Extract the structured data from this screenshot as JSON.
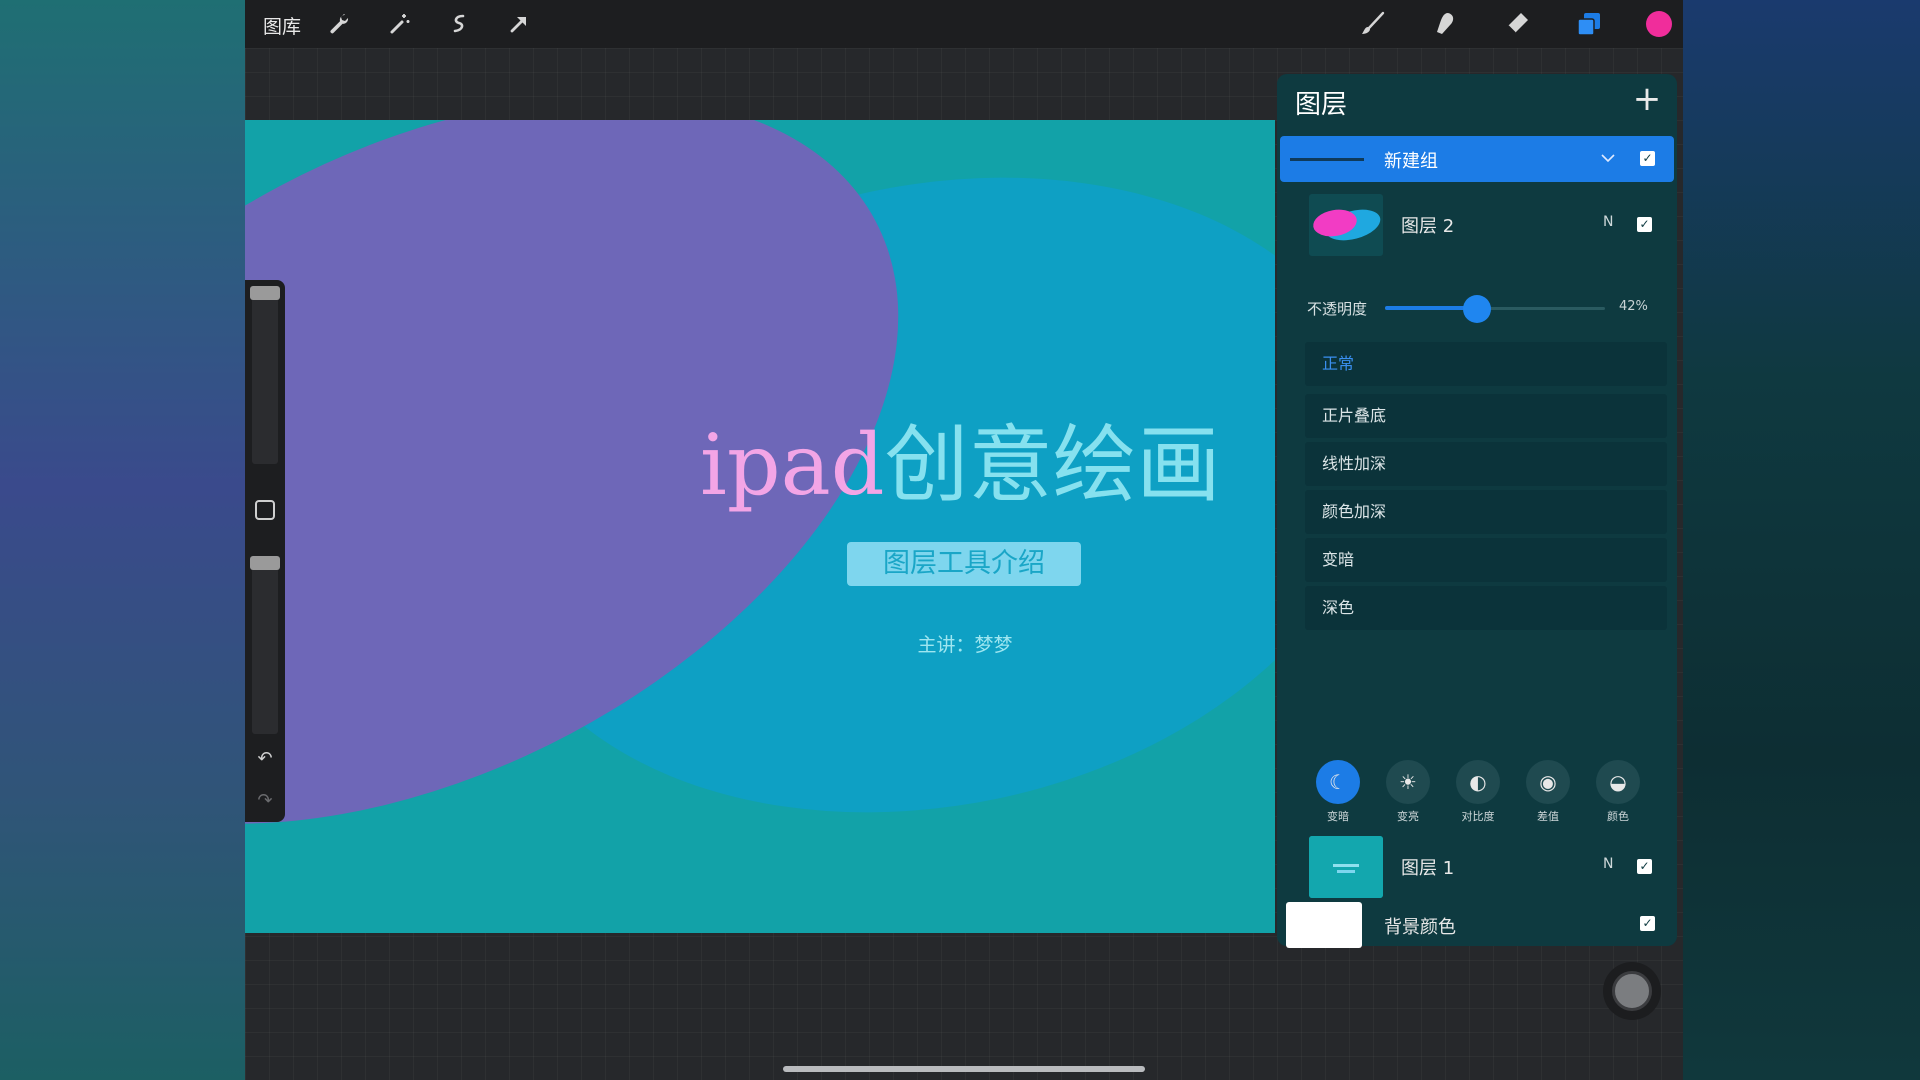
{
  "toolbar": {
    "gallery_label": "图库",
    "icons": [
      "wrench-icon",
      "magic-wand-icon",
      "selection-icon",
      "transform-arrow-icon",
      "brush-icon",
      "smudge-icon",
      "eraser-icon",
      "layers-icon",
      "color-swatch-icon"
    ],
    "color": "#f02d9b"
  },
  "canvas": {
    "title_latin": "ipad",
    "title_cjk": "创意绘画",
    "subtitle": "图层工具介绍",
    "speaker": "主讲：梦梦"
  },
  "layers_panel": {
    "title": "图层",
    "add_symbol": "+",
    "group": {
      "name": "新建组",
      "checked": true
    },
    "layer2": {
      "name": "图层 2",
      "blend": "N",
      "checked": true
    },
    "opacity": {
      "label": "不透明度",
      "value_text": "42%",
      "value": 0.42
    },
    "blend_modes": [
      {
        "label": "正常",
        "active": true
      },
      {
        "label": "正片叠底",
        "active": false
      },
      {
        "label": "线性加深",
        "active": false
      },
      {
        "label": "颜色加深",
        "active": false
      },
      {
        "label": "变暗",
        "active": false
      },
      {
        "label": "深色",
        "active": false
      }
    ],
    "mode_categories": [
      {
        "label": "变暗",
        "icon": "moon-icon",
        "active": true
      },
      {
        "label": "变亮",
        "icon": "sun-icon",
        "active": false
      },
      {
        "label": "对比度",
        "icon": "contrast-icon",
        "active": false
      },
      {
        "label": "差值",
        "icon": "difference-icon",
        "active": false
      },
      {
        "label": "颜色",
        "icon": "color-mode-icon",
        "active": false
      }
    ],
    "layer1": {
      "name": "图层 1",
      "blend": "N",
      "checked": true
    },
    "background": {
      "name": "背景颜色",
      "checked": true,
      "color": "#ffffff"
    }
  },
  "colors": {
    "accent": "#1c7ce6",
    "panel": "#0e3a40",
    "canvas_teal": "#12a2a8",
    "canvas_purple": "#6e67b8"
  }
}
